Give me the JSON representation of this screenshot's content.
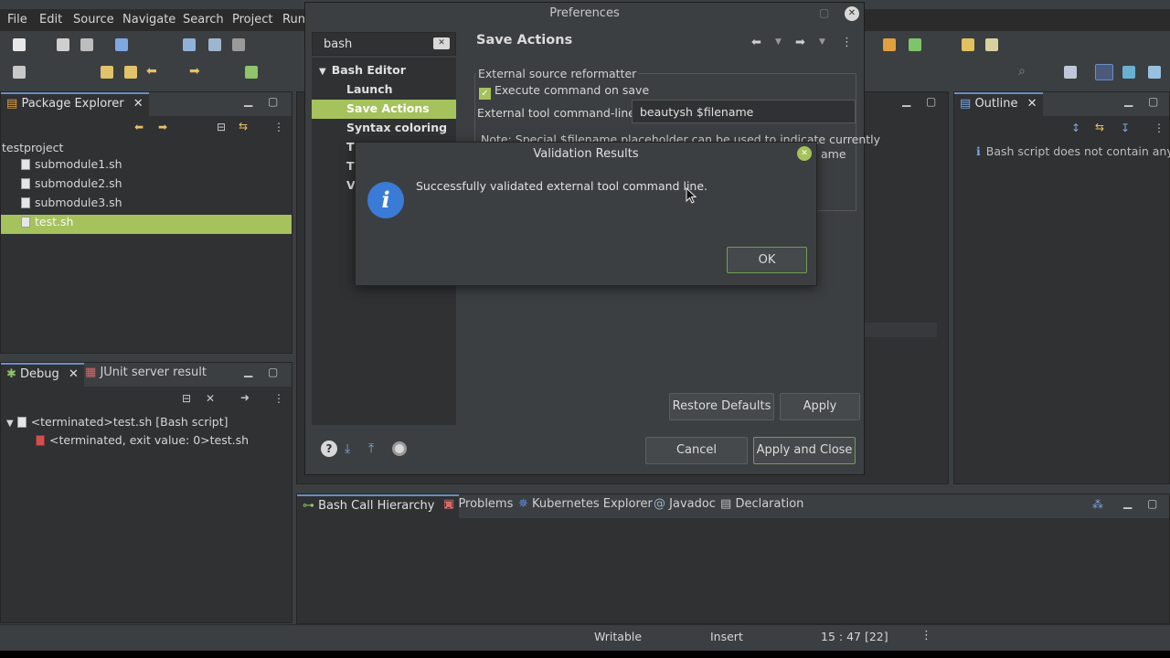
{
  "menubar": {
    "items": [
      "File",
      "Edit",
      "Source",
      "Navigate",
      "Search",
      "Project",
      "Run"
    ]
  },
  "package_explorer": {
    "tab": "Package Explorer",
    "project": "testproject",
    "files": [
      "submodule1.sh",
      "submodule2.sh",
      "submodule3.sh",
      "test.sh"
    ],
    "selected_index": 3
  },
  "debug": {
    "tab_debug": "Debug",
    "tab_junit": "JUnit server result",
    "rows": [
      "<terminated>test.sh [Bash script]",
      "<terminated, exit value: 0>test.sh"
    ]
  },
  "outline": {
    "tab": "Outline",
    "message": "Bash script does not contain any fu"
  },
  "bottom_tabs": {
    "active": "Bash Call Hierarchy",
    "others": [
      "Problems",
      "Kubernetes Explorer",
      "Javadoc",
      "Declaration"
    ]
  },
  "preferences": {
    "window_title": "Preferences",
    "filter_value": "bash",
    "page_title": "Save Actions",
    "tree": {
      "root": "Bash Editor",
      "children": [
        "Launch",
        "Save Actions",
        "Syntax coloring",
        "T",
        "T",
        "V"
      ],
      "selected_index": 1
    },
    "group_label": "External source reformatter",
    "checkbox_label": "Execute command on save",
    "cmd_label": "External tool command-line:",
    "cmd_value": "beautysh $filename",
    "note_line1": "Note: Special $filename placeholder can be used to indicate currently",
    "note_line2": "ame",
    "restore_defaults": "Restore Defaults",
    "apply": "Apply",
    "cancel": "Cancel",
    "apply_close": "Apply and Close"
  },
  "validation": {
    "title": "Validation Results",
    "message": "Successfully validated external tool command line.",
    "ok": "OK"
  },
  "status": {
    "writable": "Writable",
    "insert": "Insert",
    "position": "15 : 47 [22]"
  },
  "colors": {
    "selection_green": "#a5c25c",
    "info_blue": "#3b7bd8",
    "tab_accent": "#6a8ec3"
  }
}
